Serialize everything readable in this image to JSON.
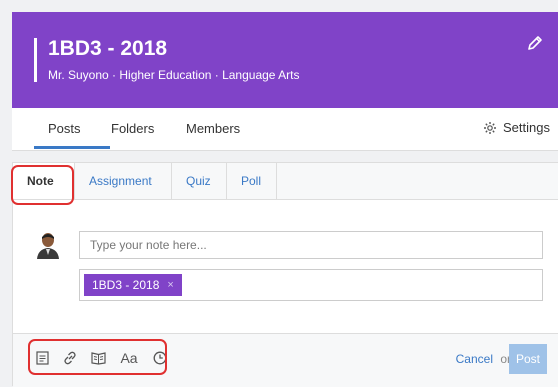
{
  "header": {
    "title": "1BD3 - 2018",
    "subtitle": "Mr. Suyono · Higher Education · Language Arts",
    "edit_icon": "pencil-icon"
  },
  "nav": {
    "tabs": [
      {
        "label": "Posts",
        "active": true
      },
      {
        "label": "Folders",
        "active": false
      },
      {
        "label": "Members",
        "active": false
      }
    ],
    "settings_label": "Settings",
    "settings_icon": "gear-icon"
  },
  "composer": {
    "types": [
      {
        "label": "Note",
        "active": true
      },
      {
        "label": "Assignment",
        "active": false
      },
      {
        "label": "Quiz",
        "active": false
      },
      {
        "label": "Poll",
        "active": false
      }
    ],
    "note_placeholder": "Type your note here...",
    "note_value": "",
    "recipient_chip": "1BD3 - 2018",
    "recipient_remove": "×",
    "tools": [
      "file-icon",
      "link-icon",
      "library-icon",
      "text-format-icon",
      "clock-icon"
    ],
    "text_format_glyph": "Aa",
    "cancel_label": "Cancel",
    "or_label": "or",
    "post_label": "Post"
  },
  "colors": {
    "header_bg": "#8043c8",
    "accent": "#3a79c6",
    "highlight": "#e03030",
    "post_disabled": "#9fc2e8"
  }
}
